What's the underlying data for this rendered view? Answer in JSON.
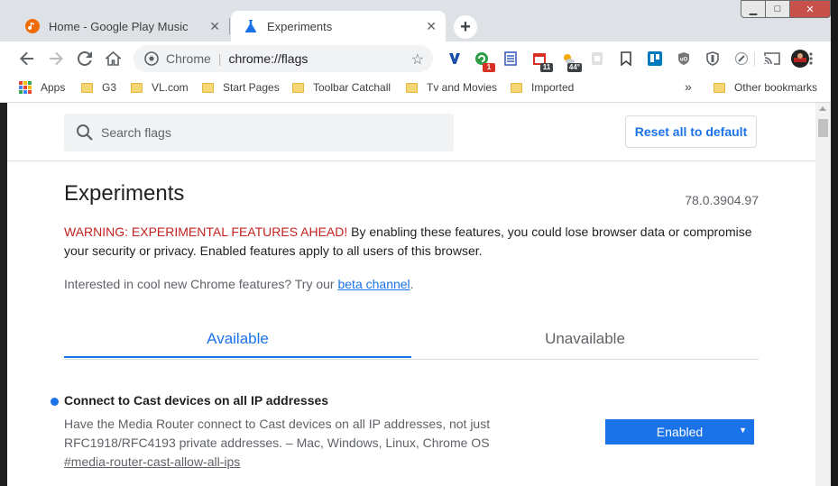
{
  "tabs": [
    {
      "title": "Home - Google Play Music",
      "favicon": "play-music-icon",
      "close": "✕"
    },
    {
      "title": "Experiments",
      "favicon": "flask-icon",
      "close": "✕"
    }
  ],
  "new_tab": "+",
  "window_controls": {
    "minimize": "▁",
    "maximize": "□",
    "close": "✕"
  },
  "omnibox": {
    "origin": "Chrome",
    "separator": "|",
    "url": "chrome://flags",
    "star": "☆"
  },
  "extensions": [
    {
      "name": "vivaldi-v-icon",
      "glyph": "Y",
      "color": "#1a4fa3"
    },
    {
      "name": "green-extension-icon",
      "glyph": "",
      "color": "#2e9e48",
      "badge": "1",
      "badge_color": "#d93025"
    },
    {
      "name": "notes-list-icon",
      "glyph": "",
      "color": "#3f5fbf"
    },
    {
      "name": "calendar-icon",
      "glyph": "",
      "color": "#d93025",
      "badge": "11",
      "badge_color": "#3c4043"
    },
    {
      "name": "weather-icon",
      "glyph": "",
      "color": "#f2a900",
      "badge": "44°",
      "badge_color": "#3c4043"
    },
    {
      "name": "grey-extension-icon",
      "glyph": "",
      "color": "#c0c0c0"
    },
    {
      "name": "bookmark-icon",
      "glyph": "",
      "color": "#3c4043"
    },
    {
      "name": "trello-icon",
      "glyph": "",
      "color": "#0079bf"
    },
    {
      "name": "ublock-icon",
      "glyph": "",
      "color": "#555555"
    },
    {
      "name": "shield-icon",
      "glyph": "",
      "color": "#5f6368"
    },
    {
      "name": "rocket-icon",
      "glyph": "",
      "color": "#5f6368"
    },
    {
      "name": "cast-icon",
      "glyph": "",
      "color": "#5f6368"
    }
  ],
  "bookmarks": {
    "apps": "Apps",
    "items": [
      "G3",
      "VL.com",
      "Start Pages",
      "Toolbar Catchall",
      "Tv and Movies",
      "Imported"
    ],
    "overflow": "»",
    "other": "Other bookmarks"
  },
  "search": {
    "placeholder": "Search flags"
  },
  "reset_button": "Reset all to default",
  "page": {
    "title": "Experiments",
    "version": "78.0.3904.97",
    "warning_strong": "WARNING: EXPERIMENTAL FEATURES AHEAD!",
    "warning_rest": " By enabling these features, you could lose browser data or compromise your security or privacy. Enabled features apply to all users of this browser.",
    "interest_text": "Interested in cool new Chrome features? Try our ",
    "interest_link": "beta channel",
    "interest_end": "."
  },
  "content_tabs": {
    "available": "Available",
    "unavailable": "Unavailable"
  },
  "flag": {
    "name": "Connect to Cast devices on all IP addresses",
    "description": "Have the Media Router connect to Cast devices on all IP addresses, not just RFC1918/RFC4193 private addresses. – Mac, Windows, Linux, Chrome OS",
    "hash": "#media-router-cast-allow-all-ips",
    "value": "Enabled",
    "arrow": "▼"
  },
  "colors": {
    "accent": "#1a73e8",
    "warning": "#c5221f"
  }
}
